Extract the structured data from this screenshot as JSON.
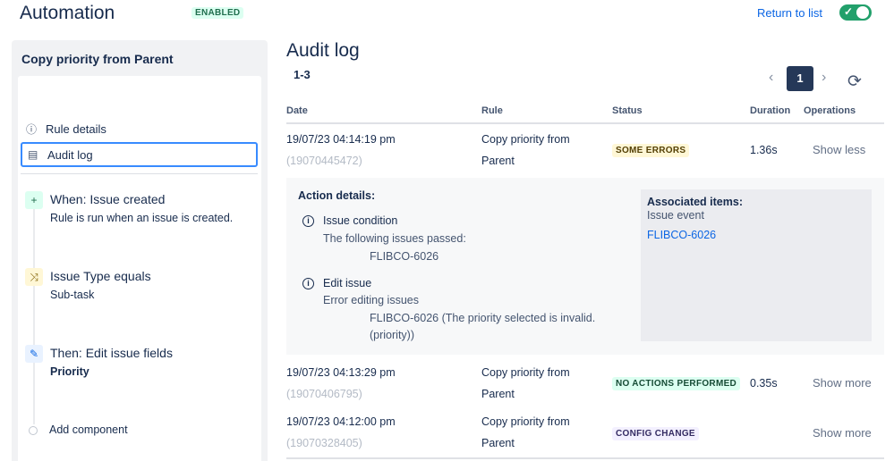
{
  "header": {
    "title": "Automation",
    "enabled_badge": "ENABLED",
    "return_link": "Return to list",
    "toggle_on": true
  },
  "sidebar": {
    "rule_name": "Copy priority from Parent",
    "nav": [
      {
        "label": "Rule details",
        "icon": "info-icon"
      },
      {
        "label": "Audit log",
        "icon": "document-icon",
        "active": true
      }
    ],
    "steps": [
      {
        "title": "When: Issue created",
        "sub": "Rule is run when an issue is created.",
        "icon": "plus-icon"
      },
      {
        "title": "Issue Type equals",
        "sub": "Sub-task",
        "icon": "shuffle-icon"
      },
      {
        "title": "Then: Edit issue fields",
        "sub": "Priority",
        "icon": "pencil-icon"
      }
    ],
    "add_component": "Add component"
  },
  "main": {
    "title": "Audit log",
    "range": "1-3",
    "pager": {
      "current": "1"
    },
    "columns": {
      "date": "Date",
      "rule": "Rule",
      "status": "Status",
      "duration": "Duration",
      "operations": "Operations"
    },
    "rows": [
      {
        "date": "19/07/23 04:14:19 pm",
        "id": "(19070445472)",
        "rule_line1": "Copy priority from",
        "rule_line2": "Parent",
        "status": "SOME ERRORS",
        "duration": "1.36s",
        "operation": "Show less"
      },
      {
        "date": "19/07/23 04:13:29 pm",
        "id": "(19070406795)",
        "rule_line1": "Copy priority from",
        "rule_line2": "Parent",
        "status": "NO ACTIONS PERFORMED",
        "duration": "0.35s",
        "operation": "Show more"
      },
      {
        "date": "19/07/23 04:12:00 pm",
        "id": "(19070328405)",
        "rule_line1": "Copy priority from",
        "rule_line2": "Parent",
        "status": "CONFIG CHANGE",
        "duration": "",
        "operation": "Show more"
      }
    ],
    "details": {
      "title": "Action details:",
      "items": [
        {
          "name": "Issue condition",
          "desc": "The following issues passed:",
          "value": "FLIBCO-6026",
          "value2": ""
        },
        {
          "name": "Edit issue",
          "desc": "Error editing issues",
          "value": "FLIBCO-6026 (The priority selected is invalid.",
          "value2": "(priority))"
        }
      ],
      "associated": {
        "title": "Associated items:",
        "sub": "Issue event",
        "link": "FLIBCO-6026"
      }
    }
  },
  "colors": {
    "accent": "#0c66e4",
    "toggle": "#22a06b",
    "pager_active": "#253858"
  }
}
